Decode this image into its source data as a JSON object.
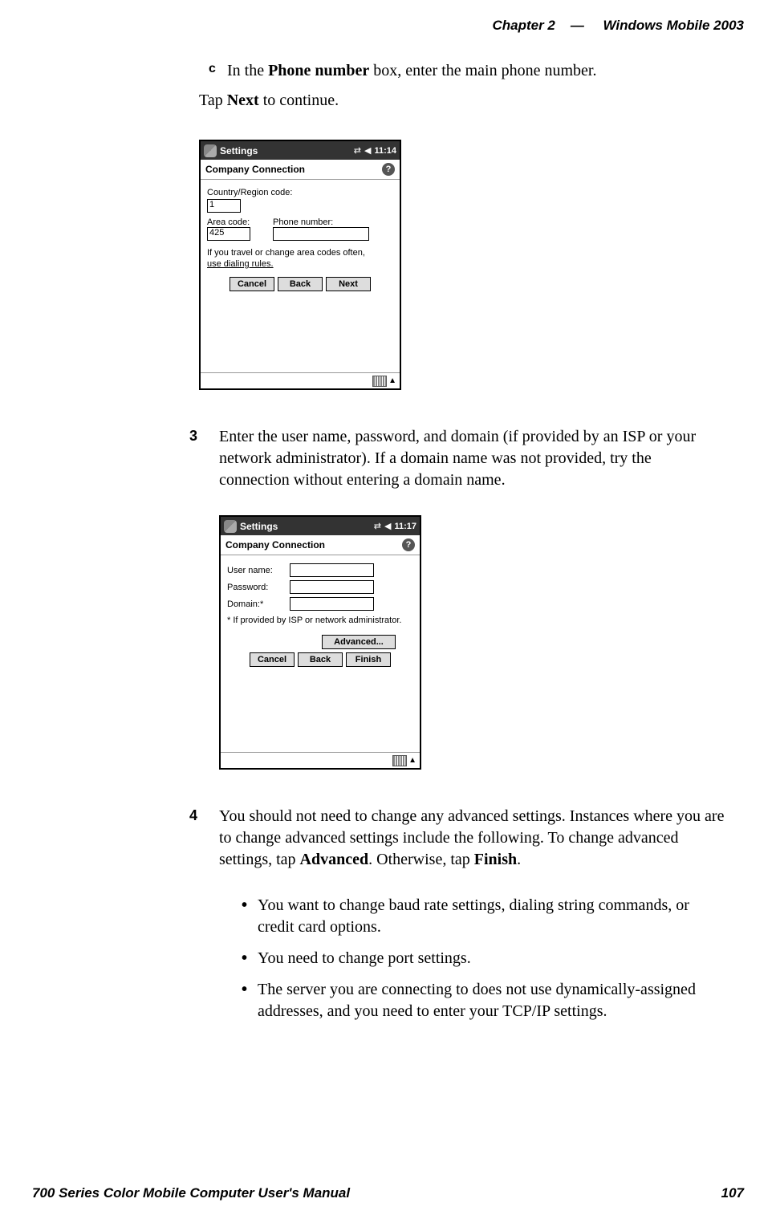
{
  "header": {
    "chapter": "Chapter",
    "chapter_num": "2",
    "dash": "—",
    "product": "Windows Mobile 2003"
  },
  "item_c": {
    "label": "c",
    "text_before": "In the ",
    "text_bold": "Phone number",
    "text_after": " box, enter the main phone number."
  },
  "tap_line": {
    "pre": "Tap ",
    "bold": "Next",
    "post": " to continue."
  },
  "screenshot1": {
    "topbar_title": "Settings",
    "time": "11:14",
    "header2": "Company Connection",
    "label_country": "Country/Region code:",
    "value_country": "1",
    "label_area": "Area code:",
    "value_area": "425",
    "label_phone": "Phone number:",
    "note_line1": "If you travel or change area codes often,",
    "note_line2_link": "use dialing rules.",
    "btn_cancel": "Cancel",
    "btn_back": "Back",
    "btn_next": "Next"
  },
  "step3": {
    "num": "3",
    "text": "Enter the user name, password, and domain (if provided by an ISP or your network administrator). If a domain name was not provided, try the connection without entering a domain name."
  },
  "screenshot2": {
    "topbar_title": "Settings",
    "time": "11:17",
    "header2": "Company Connection",
    "label_user": "User name:",
    "label_pass": "Password:",
    "label_domain": "Domain:*",
    "note": "* If provided by ISP or network administrator.",
    "btn_advanced": "Advanced...",
    "btn_cancel": "Cancel",
    "btn_back": "Back",
    "btn_finish": "Finish"
  },
  "step4": {
    "num": "4",
    "text_a": "You should not need to change any advanced settings. Instances where you are to change advanced settings include the following. To change advanced settings, tap ",
    "bold_a": "Advanced",
    "text_b": ". Otherwise, tap ",
    "bold_b": "Finish",
    "text_c": ".",
    "bullets": [
      "You want to change baud rate settings, dialing string commands, or credit card options.",
      "You need to change port settings.",
      "The server you are connecting to does not use dynamically-assigned addresses, and you need to enter your TCP/IP settings."
    ]
  },
  "footer": {
    "manual": "700 Series Color Mobile Computer User's Manual",
    "page": "107"
  }
}
